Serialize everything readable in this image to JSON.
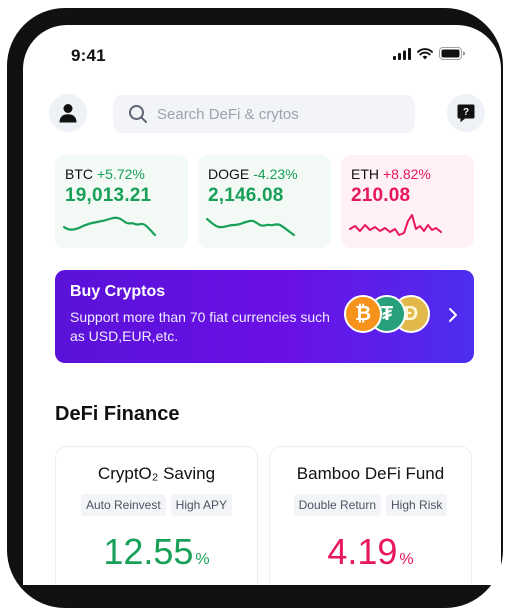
{
  "status_bar": {
    "time": "9:41"
  },
  "search": {
    "placeholder": "Search DeFi & crytos"
  },
  "tickers": [
    {
      "symbol": "BTC",
      "change": "+5.72%",
      "price": "19,013.21",
      "trend": "up"
    },
    {
      "symbol": "DOGE",
      "change": "-4.23%",
      "price": "2,146.08",
      "trend": "down"
    },
    {
      "symbol": "ETH",
      "change": "+8.82%",
      "price": "210.08",
      "trend": "up"
    }
  ],
  "banner": {
    "title": "Buy Cryptos",
    "subtitle": "Support more than 70 fiat currencies such as USD,EUR,etc.",
    "coins": [
      "bitcoin-icon",
      "tether-icon",
      "dogecoin-icon"
    ]
  },
  "defi": {
    "title": "DeFi Finance",
    "funds": [
      {
        "name": "CryptO₂ Saving",
        "tags": [
          "Auto Reinvest",
          "High APY"
        ],
        "rate": "12.55",
        "unit": "%"
      },
      {
        "name": "Bamboo DeFi Fund",
        "tags": [
          "Double Return",
          "High Risk"
        ],
        "rate": "4.19",
        "unit": "%"
      }
    ]
  },
  "colors": {
    "positive": "#18a058",
    "negative": "#e8175d",
    "banner_start": "#5a12d8",
    "banner_end": "#4d2ef0"
  }
}
